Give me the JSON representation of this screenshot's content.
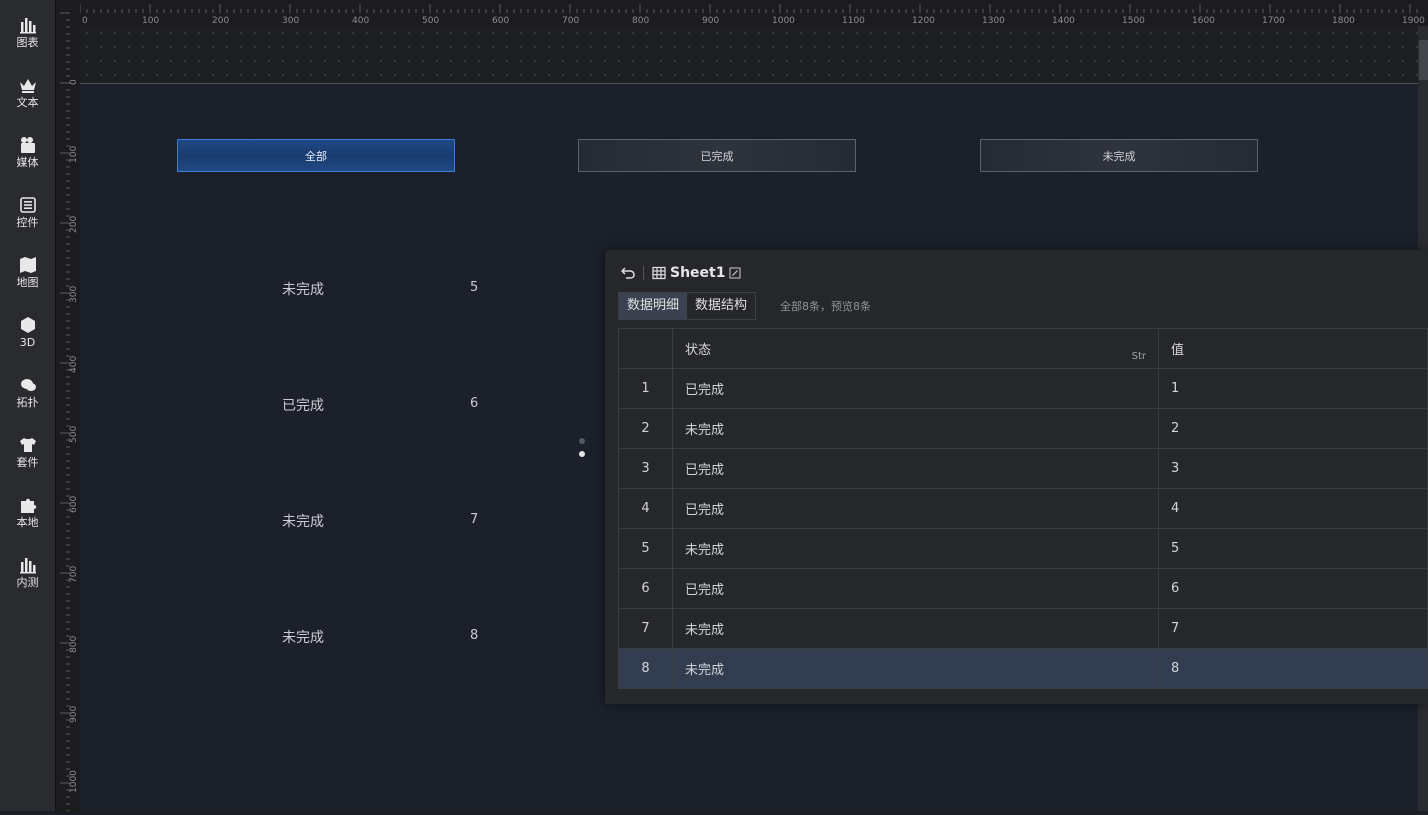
{
  "sidebar": {
    "items": [
      {
        "label": "图表",
        "icon": "bar-chart-icon"
      },
      {
        "label": "文本",
        "icon": "crown-icon"
      },
      {
        "label": "媒体",
        "icon": "media-icon"
      },
      {
        "label": "控件",
        "icon": "list-icon"
      },
      {
        "label": "地图",
        "icon": "map-icon"
      },
      {
        "label": "3D",
        "icon": "cube-icon"
      },
      {
        "label": "拓扑",
        "icon": "cloud-icon"
      },
      {
        "label": "套件",
        "icon": "shirt-icon"
      },
      {
        "label": "本地",
        "icon": "puzzle-icon"
      },
      {
        "label": "内测",
        "icon": "bar-chart-icon"
      }
    ]
  },
  "ruler": {
    "h_labels": [
      "0",
      "100",
      "200",
      "300",
      "400",
      "500",
      "600",
      "700",
      "800",
      "900",
      "1000",
      "1100",
      "1200",
      "1300",
      "1400",
      "1500",
      "1600",
      "1700",
      "1800",
      "1900"
    ],
    "v_labels": [
      "0",
      "100",
      "200",
      "300",
      "400",
      "500",
      "600",
      "700",
      "800",
      "900",
      "1000"
    ]
  },
  "filters": {
    "all": "全部",
    "done": "已完成",
    "undone": "未完成"
  },
  "list": [
    {
      "status": "未完成",
      "value": "5"
    },
    {
      "status": "已完成",
      "value": "6"
    },
    {
      "status": "未完成",
      "value": "7"
    },
    {
      "status": "未完成",
      "value": "8"
    }
  ],
  "panel": {
    "sheet_name": "Sheet1",
    "tabs": {
      "detail": "数据明细",
      "structure": "数据结构"
    },
    "preview_info": "全部8条，预览8条",
    "columns": {
      "status": "状态",
      "status_type": "Str",
      "value": "值"
    },
    "rows": [
      {
        "idx": "1",
        "status": "已完成",
        "value": "1"
      },
      {
        "idx": "2",
        "status": "未完成",
        "value": "2"
      },
      {
        "idx": "3",
        "status": "已完成",
        "value": "3"
      },
      {
        "idx": "4",
        "status": "已完成",
        "value": "4"
      },
      {
        "idx": "5",
        "status": "未完成",
        "value": "5"
      },
      {
        "idx": "6",
        "status": "已完成",
        "value": "6"
      },
      {
        "idx": "7",
        "status": "未完成",
        "value": "7"
      },
      {
        "idx": "8",
        "status": "未完成",
        "value": "8"
      }
    ]
  },
  "colors": {
    "accent": "#3c7bd6",
    "selected_row": "#333d50"
  }
}
